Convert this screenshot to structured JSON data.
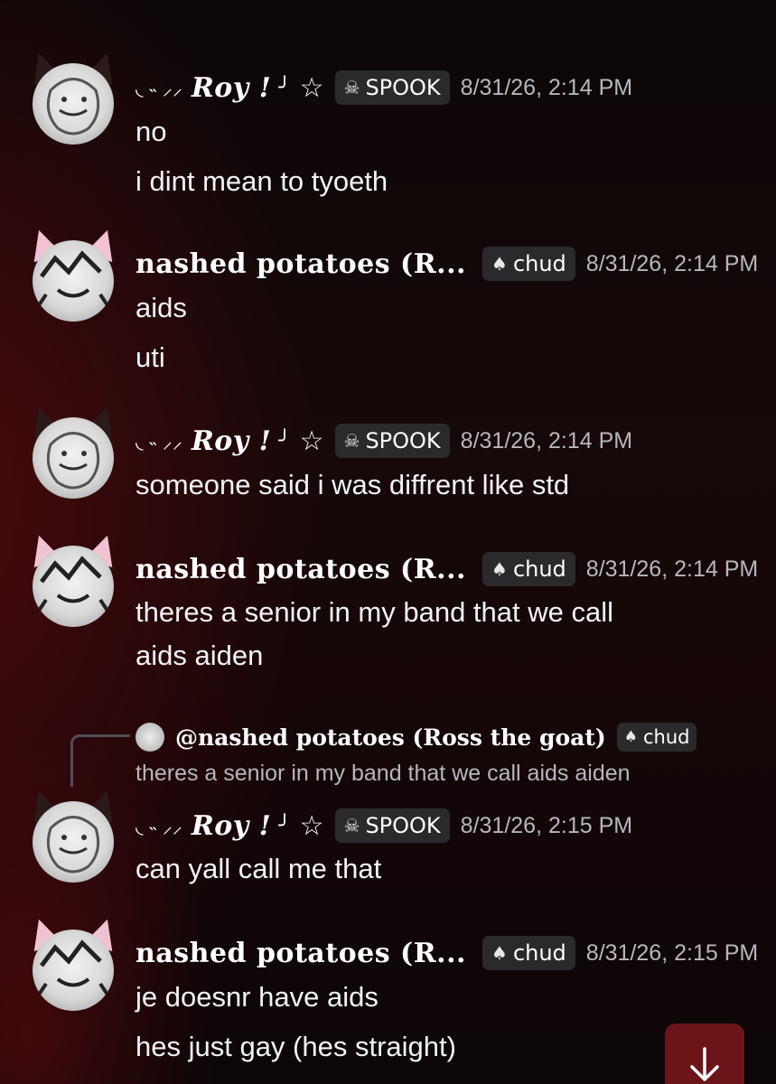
{
  "messages": [
    {
      "author": "Roy",
      "deco_prefix": "◟ ˵ ⸝⸝",
      "name": "Roy !",
      "deco_suffix": "╯",
      "star": "☆",
      "tag": "SPOOK",
      "tag_icon": "skull-icon",
      "timestamp": "8/31/26, 2:14 PM",
      "lines": [
        "no",
        "i dint mean to tyoeth"
      ]
    },
    {
      "author": "nashed",
      "name": "nashed potatoes (R...",
      "tag": "chud",
      "tag_icon": "mushroom-icon",
      "timestamp": "8/31/26, 2:14 PM",
      "lines": [
        "aids",
        "uti"
      ]
    },
    {
      "author": "Roy",
      "deco_prefix": "◟ ˵ ⸝⸝",
      "name": "Roy !",
      "deco_suffix": "╯",
      "star": "☆",
      "tag": "SPOOK",
      "tag_icon": "skull-icon",
      "timestamp": "8/31/26, 2:14 PM",
      "lines": [
        "someone said i was diffrent like std"
      ]
    },
    {
      "author": "nashed",
      "name": "nashed potatoes (R...",
      "tag": "chud",
      "tag_icon": "mushroom-icon",
      "timestamp": "8/31/26, 2:14 PM",
      "lines": [
        "theres a senior in my band that we call",
        "aids aiden"
      ]
    },
    {
      "author": "Roy",
      "deco_prefix": "◟ ˵ ⸝⸝",
      "name": "Roy !",
      "deco_suffix": "╯",
      "star": "☆",
      "tag": "SPOOK",
      "tag_icon": "skull-icon",
      "timestamp": "8/31/26, 2:15 PM",
      "lines": [
        "can yall call me that"
      ]
    },
    {
      "author": "nashed",
      "name": "nashed potatoes (R...",
      "tag": "chud",
      "tag_icon": "mushroom-icon",
      "timestamp": "8/31/26, 2:15 PM",
      "lines": [
        "je doesnr have aids",
        "hes just gay (hes straight)"
      ]
    }
  ],
  "reply": {
    "name": "@nashed potatoes (Ross the goat)",
    "tag": "chud",
    "text": "theres a senior in my band that we call aids aiden"
  },
  "jump_button": {
    "icon": "arrow-down-icon"
  },
  "colors": {
    "tag_bg": "#2a2a2d",
    "timestamp": "#b5b7bd",
    "jump_bg": "#6b1518"
  }
}
